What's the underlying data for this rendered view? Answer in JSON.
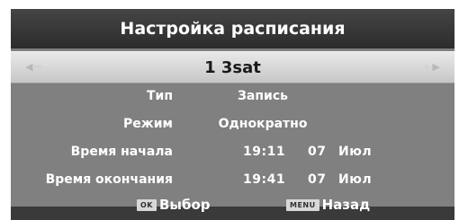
{
  "header": {
    "title": "Настройка расписания"
  },
  "channel": {
    "name": "1 3sat",
    "left_arrow_icon": "arrow-left-icon",
    "right_arrow_icon": "arrow-right-icon"
  },
  "fields": [
    {
      "label": "Тип",
      "value": "Запись"
    },
    {
      "label": "Режим",
      "value": "Однократно"
    },
    {
      "label": "Время начала",
      "time": "19:11",
      "day": "07",
      "month": "Июл"
    },
    {
      "label": "Время окончания",
      "time": "19:41",
      "day": "07",
      "month": "Июл"
    }
  ],
  "footer": {
    "ok_key": "OK",
    "ok_label": "Выбор",
    "menu_key": "MENU",
    "menu_label": "Назад"
  }
}
